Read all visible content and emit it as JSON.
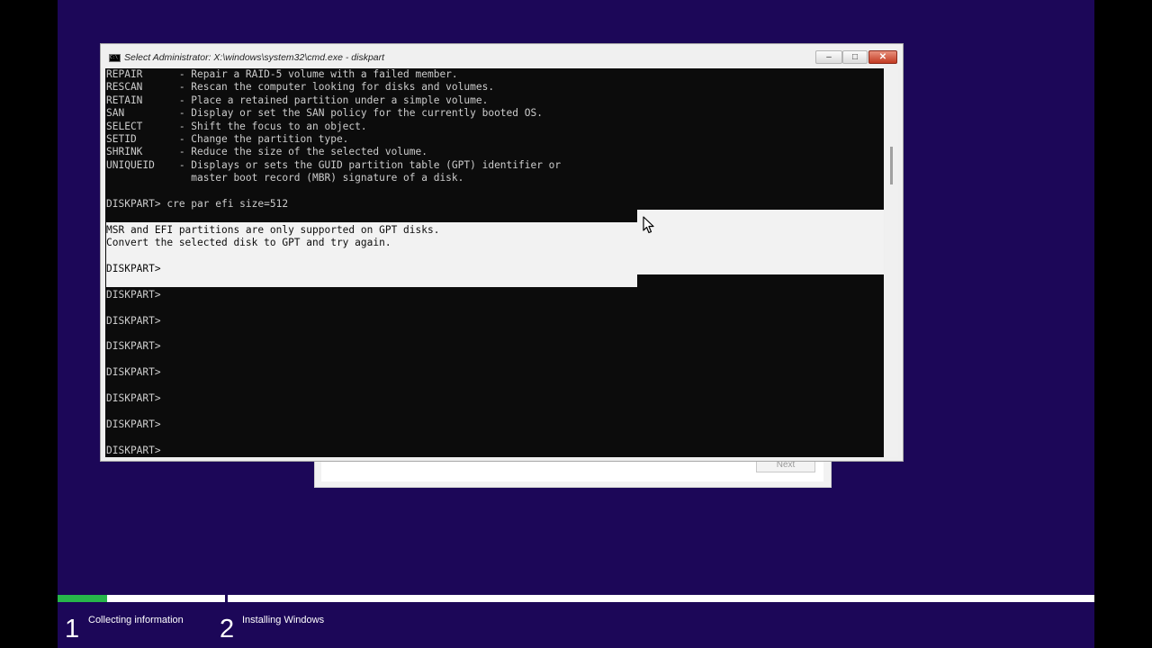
{
  "window": {
    "title": "Select Administrator: X:\\windows\\system32\\cmd.exe - diskpart",
    "icon_label": "C:\\",
    "buttons": {
      "minimize": "–",
      "maximize": "□",
      "close": "✕"
    }
  },
  "console": {
    "lines": [
      "REPAIR      - Repair a RAID-5 volume with a failed member.",
      "RESCAN      - Rescan the computer looking for disks and volumes.",
      "RETAIN      - Place a retained partition under a simple volume.",
      "SAN         - Display or set the SAN policy for the currently booted OS.",
      "SELECT      - Shift the focus to an object.",
      "SETID       - Change the partition type.",
      "SHRINK      - Reduce the size of the selected volume.",
      "UNIQUEID    - Displays or sets the GUID partition table (GPT) identifier or",
      "              master boot record (MBR) signature of a disk.",
      "",
      "DISKPART> cre par efi size=512",
      "",
      "MSR and EFI partitions are only supported on GPT disks.",
      "Convert the selected disk to GPT and try again.",
      "",
      "DISKPART>",
      "",
      "DISKPART>",
      "",
      "DISKPART>",
      "",
      "DISKPART>",
      "",
      "DISKPART>",
      "",
      "DISKPART>",
      "",
      "DISKPART>",
      "",
      "DISKPART>"
    ],
    "selected_line_indexes": [
      12,
      13,
      14,
      15
    ]
  },
  "setup": {
    "next_label": "Next",
    "steps": [
      {
        "number": "1",
        "label": "Collecting information"
      },
      {
        "number": "2",
        "label": "Installing Windows"
      }
    ],
    "progress_fraction": 0.048
  },
  "colors": {
    "setup_background": "#1c0758",
    "console_background": "#0c0c0c",
    "console_text": "#cccccc",
    "selection_highlight": "#f2f2f2",
    "progress_green": "#27b64a"
  }
}
